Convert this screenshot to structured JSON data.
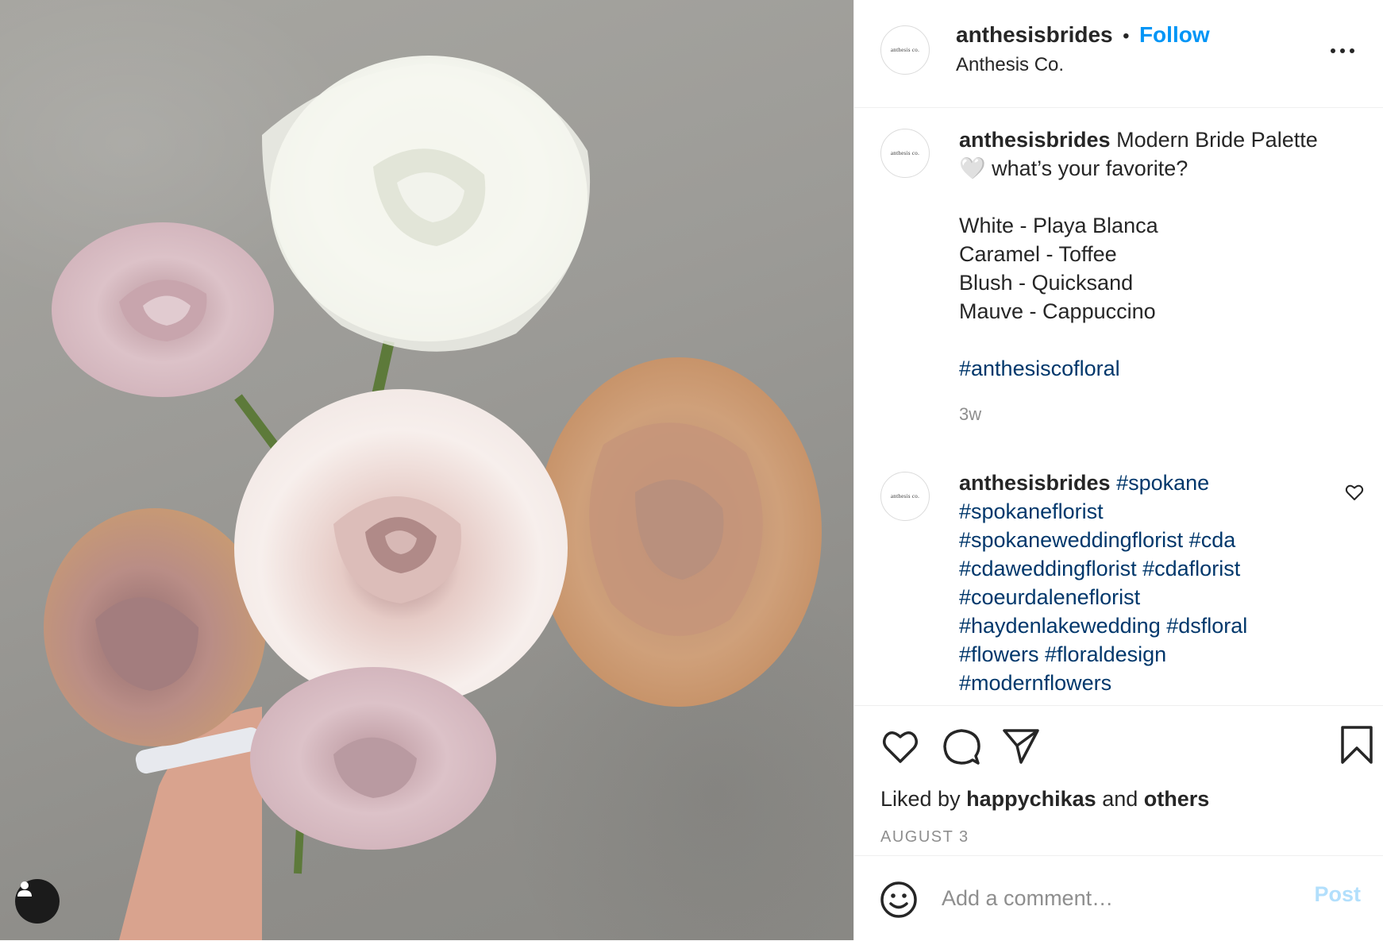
{
  "post": {
    "author": "anthesisbrides",
    "author_display": "Anthesis Co.",
    "follow_label": "Follow",
    "avatar_text": "anthesis co.",
    "image_description": "roses-bouquet"
  },
  "caption": {
    "username": "anthesisbrides",
    "line1": "Modern Bride Palette",
    "line2": "🤍 what’s your favorite?",
    "palette": [
      "White - Playa Blanca",
      "Caramel - Toffee",
      "Blush - Quicksand",
      "Mauve - Cappuccino"
    ],
    "hashtag": "#anthesiscofloral",
    "time": "3w"
  },
  "comment": {
    "username": "anthesisbrides",
    "lines": [
      "#spokane",
      "#spokaneflorist",
      "#spokaneweddingflorist #cda",
      "#cdaweddingflorist #cdaflorist",
      "#coeurdaleneflorist",
      "#haydenlakewedding #dsfloral",
      "#flowers #floraldesign",
      "#modernflowers"
    ]
  },
  "likes": {
    "prefix": "Liked by",
    "user": "happychikas",
    "and": "and",
    "others": "others"
  },
  "date": "AUGUST 3",
  "composer": {
    "placeholder": "Add a comment…",
    "post_label": "Post"
  },
  "icons": {
    "like": "heart-icon",
    "comment": "comment-icon",
    "share": "share-icon",
    "save": "bookmark-icon",
    "emoji": "emoji-icon",
    "more": "more-icon",
    "user_tag": "user-icon"
  },
  "colors": {
    "link": "#0095f6",
    "hashtag": "#00376b",
    "muted": "#8e8e8e",
    "post_disabled": "#b2dffc"
  }
}
